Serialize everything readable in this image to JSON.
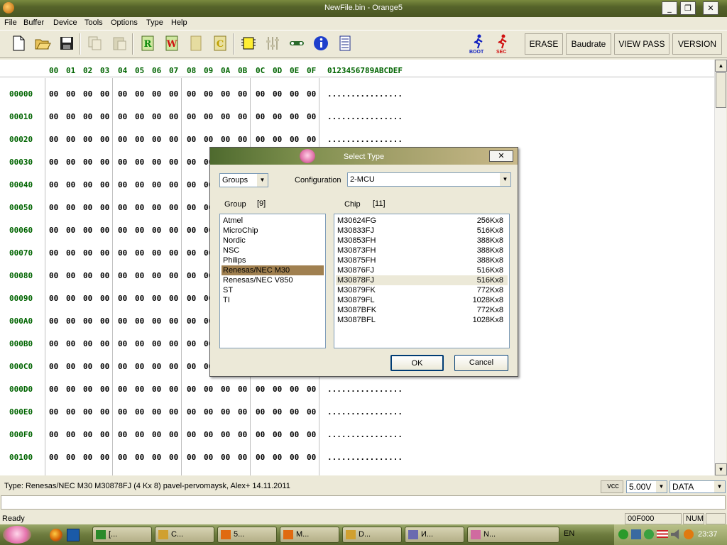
{
  "window": {
    "title": "NewFile.bin - Orange5",
    "min_label": "_",
    "restore_label": "❐",
    "close_label": "✕"
  },
  "menu": [
    "File",
    "Buffer",
    "Device",
    "Tools",
    "Options",
    "Type",
    "Help"
  ],
  "toolbar": {
    "boot_label": "BOOT",
    "sec_label": "SEC",
    "buttons": [
      "ERASE",
      "Baudrate",
      "VIEW PASS",
      "VERSION"
    ]
  },
  "hex": {
    "columns": [
      "00",
      "01",
      "02",
      "03",
      "04",
      "05",
      "06",
      "07",
      "08",
      "09",
      "0A",
      "0B",
      "0C",
      "0D",
      "0E",
      "0F"
    ],
    "ascii_header": "0123456789ABCDEF",
    "rows": [
      {
        "addr": "00000",
        "byte": "00",
        "ascii": "................"
      },
      {
        "addr": "00010",
        "byte": "00",
        "ascii": "................"
      },
      {
        "addr": "00020",
        "byte": "00",
        "ascii": "................"
      },
      {
        "addr": "00030",
        "byte": "00",
        "ascii": "................"
      },
      {
        "addr": "00040",
        "byte": "00",
        "ascii": "................"
      },
      {
        "addr": "00050",
        "byte": "00",
        "ascii": "................"
      },
      {
        "addr": "00060",
        "byte": "00",
        "ascii": "................"
      },
      {
        "addr": "00070",
        "byte": "00",
        "ascii": "................"
      },
      {
        "addr": "00080",
        "byte": "00",
        "ascii": "................"
      },
      {
        "addr": "00090",
        "byte": "00",
        "ascii": "................"
      },
      {
        "addr": "000A0",
        "byte": "00",
        "ascii": "................"
      },
      {
        "addr": "000B0",
        "byte": "00",
        "ascii": "................"
      },
      {
        "addr": "000C0",
        "byte": "00",
        "ascii": "................"
      },
      {
        "addr": "000D0",
        "byte": "00",
        "ascii": "................"
      },
      {
        "addr": "000E0",
        "byte": "00",
        "ascii": "................"
      },
      {
        "addr": "000F0",
        "byte": "00",
        "ascii": "................"
      },
      {
        "addr": "00100",
        "byte": "00",
        "ascii": "................"
      }
    ]
  },
  "dialog": {
    "title": "Select Type",
    "close_label": "✕",
    "groups_combo": "Groups",
    "configuration_label": "Configuration",
    "configuration_value": "2-MCU",
    "group_header": "Group",
    "group_count": "[9]",
    "chip_header": "Chip",
    "chip_count": "[11]",
    "groups": [
      "Atmel",
      "MicroChip",
      "Nordic",
      "NSC",
      "Philips",
      "Renesas/NEC M30",
      "Renesas/NEC V850",
      "ST",
      "TI"
    ],
    "selected_group": "Renesas/NEC M30",
    "chips": [
      {
        "name": "M30624FG",
        "size": "256Kx8"
      },
      {
        "name": "M30833FJ",
        "size": "516Kx8"
      },
      {
        "name": "M30853FH",
        "size": "388Kx8"
      },
      {
        "name": "M30873FH",
        "size": "388Kx8"
      },
      {
        "name": "M30875FH",
        "size": "388Kx8"
      },
      {
        "name": "M30876FJ",
        "size": "516Kx8"
      },
      {
        "name": "M30878FJ",
        "size": "516Kx8"
      },
      {
        "name": "M30879FK",
        "size": "772Kx8"
      },
      {
        "name": "M30879FL",
        "size": "1028Kx8"
      },
      {
        "name": "M3087BFK",
        "size": "772Kx8"
      },
      {
        "name": "M3087BFL",
        "size": "1028Kx8"
      }
    ],
    "selected_chip": "M30878FJ",
    "ok_label": "OK",
    "cancel_label": "Cancel"
  },
  "typebar": {
    "text": "Type: Renesas/NEC M30 M30878FJ (4 Kx 8)  pavel-pervomaysk, Alex+ 14.11.2011",
    "vcc_label": "vcc",
    "voltage": "5.00V",
    "mode": "DATA"
  },
  "statusbar": {
    "ready": "Ready",
    "address": "00F000",
    "num": "NUM"
  },
  "taskbar": {
    "buttons": [
      "[...",
      "C...",
      "5...",
      "M...",
      "D...",
      "И...",
      "N..."
    ],
    "lang": "EN",
    "time": "23:37"
  },
  "colors": {
    "hex_address": "#006400",
    "selection": "#a08050",
    "title_bar": "#55632a"
  }
}
